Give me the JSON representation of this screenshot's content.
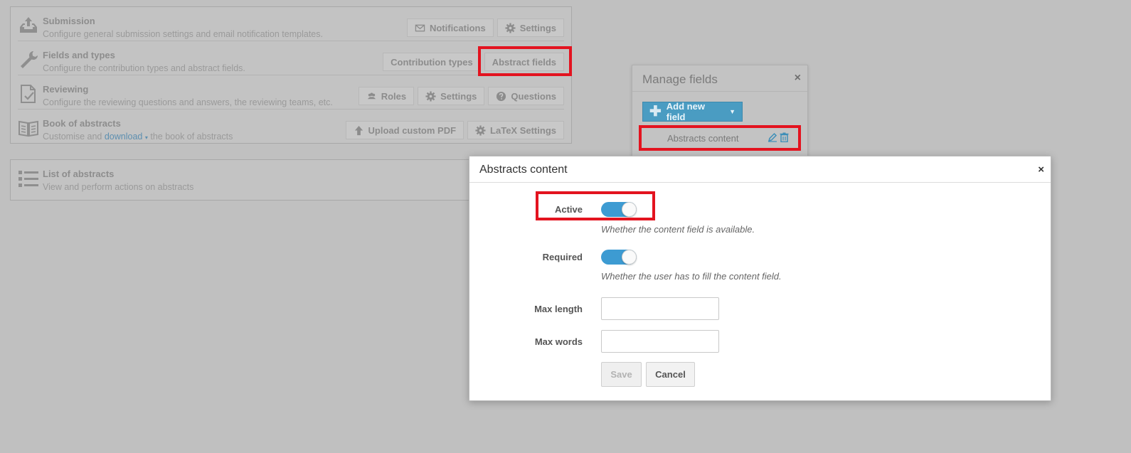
{
  "settings": {
    "rows": [
      {
        "title": "Submission",
        "description": "Configure general submission settings and email notification templates.",
        "actions": [
          {
            "label": "Notifications",
            "icon": "envelope-icon"
          },
          {
            "label": "Settings",
            "icon": "gear-icon"
          }
        ]
      },
      {
        "title": "Fields and types",
        "description": "Configure the contribution types and abstract fields.",
        "actions": [
          {
            "label": "Contribution types"
          },
          {
            "label": "Abstract fields"
          }
        ]
      },
      {
        "title": "Reviewing",
        "description": "Configure the reviewing questions and answers, the reviewing teams, etc.",
        "actions": [
          {
            "label": "Roles",
            "icon": "users-icon"
          },
          {
            "label": "Settings",
            "icon": "gear-icon"
          },
          {
            "label": "Questions",
            "icon": "question-icon"
          }
        ]
      },
      {
        "title": "Book of abstracts",
        "description_before": "Customise and",
        "description_link": "download",
        "description_after": "the book of abstracts",
        "actions": [
          {
            "label": "Upload custom PDF",
            "icon": "upload-icon"
          },
          {
            "label": "LaTeX Settings",
            "icon": "gear-icon"
          }
        ]
      }
    ],
    "list": {
      "title": "List of abstracts",
      "description": "View and perform actions on abstracts"
    }
  },
  "manage_fields": {
    "title": "Manage fields",
    "close": "×",
    "add_button": "Add new field",
    "fields": [
      {
        "label": "Abstracts content"
      }
    ]
  },
  "dialog": {
    "title": "Abstracts content",
    "close": "×",
    "active": {
      "label": "Active",
      "checked": true,
      "hint": "Whether the content field is available."
    },
    "required": {
      "label": "Required",
      "checked": true,
      "hint": "Whether the user has to fill the content field."
    },
    "max_length": {
      "label": "Max length",
      "value": ""
    },
    "max_words": {
      "label": "Max words",
      "value": ""
    },
    "save": "Save",
    "cancel": "Cancel"
  },
  "colors": {
    "highlight": "#e3131f",
    "accent": "#3d9bd2",
    "overlay": "#c0c0c0"
  }
}
